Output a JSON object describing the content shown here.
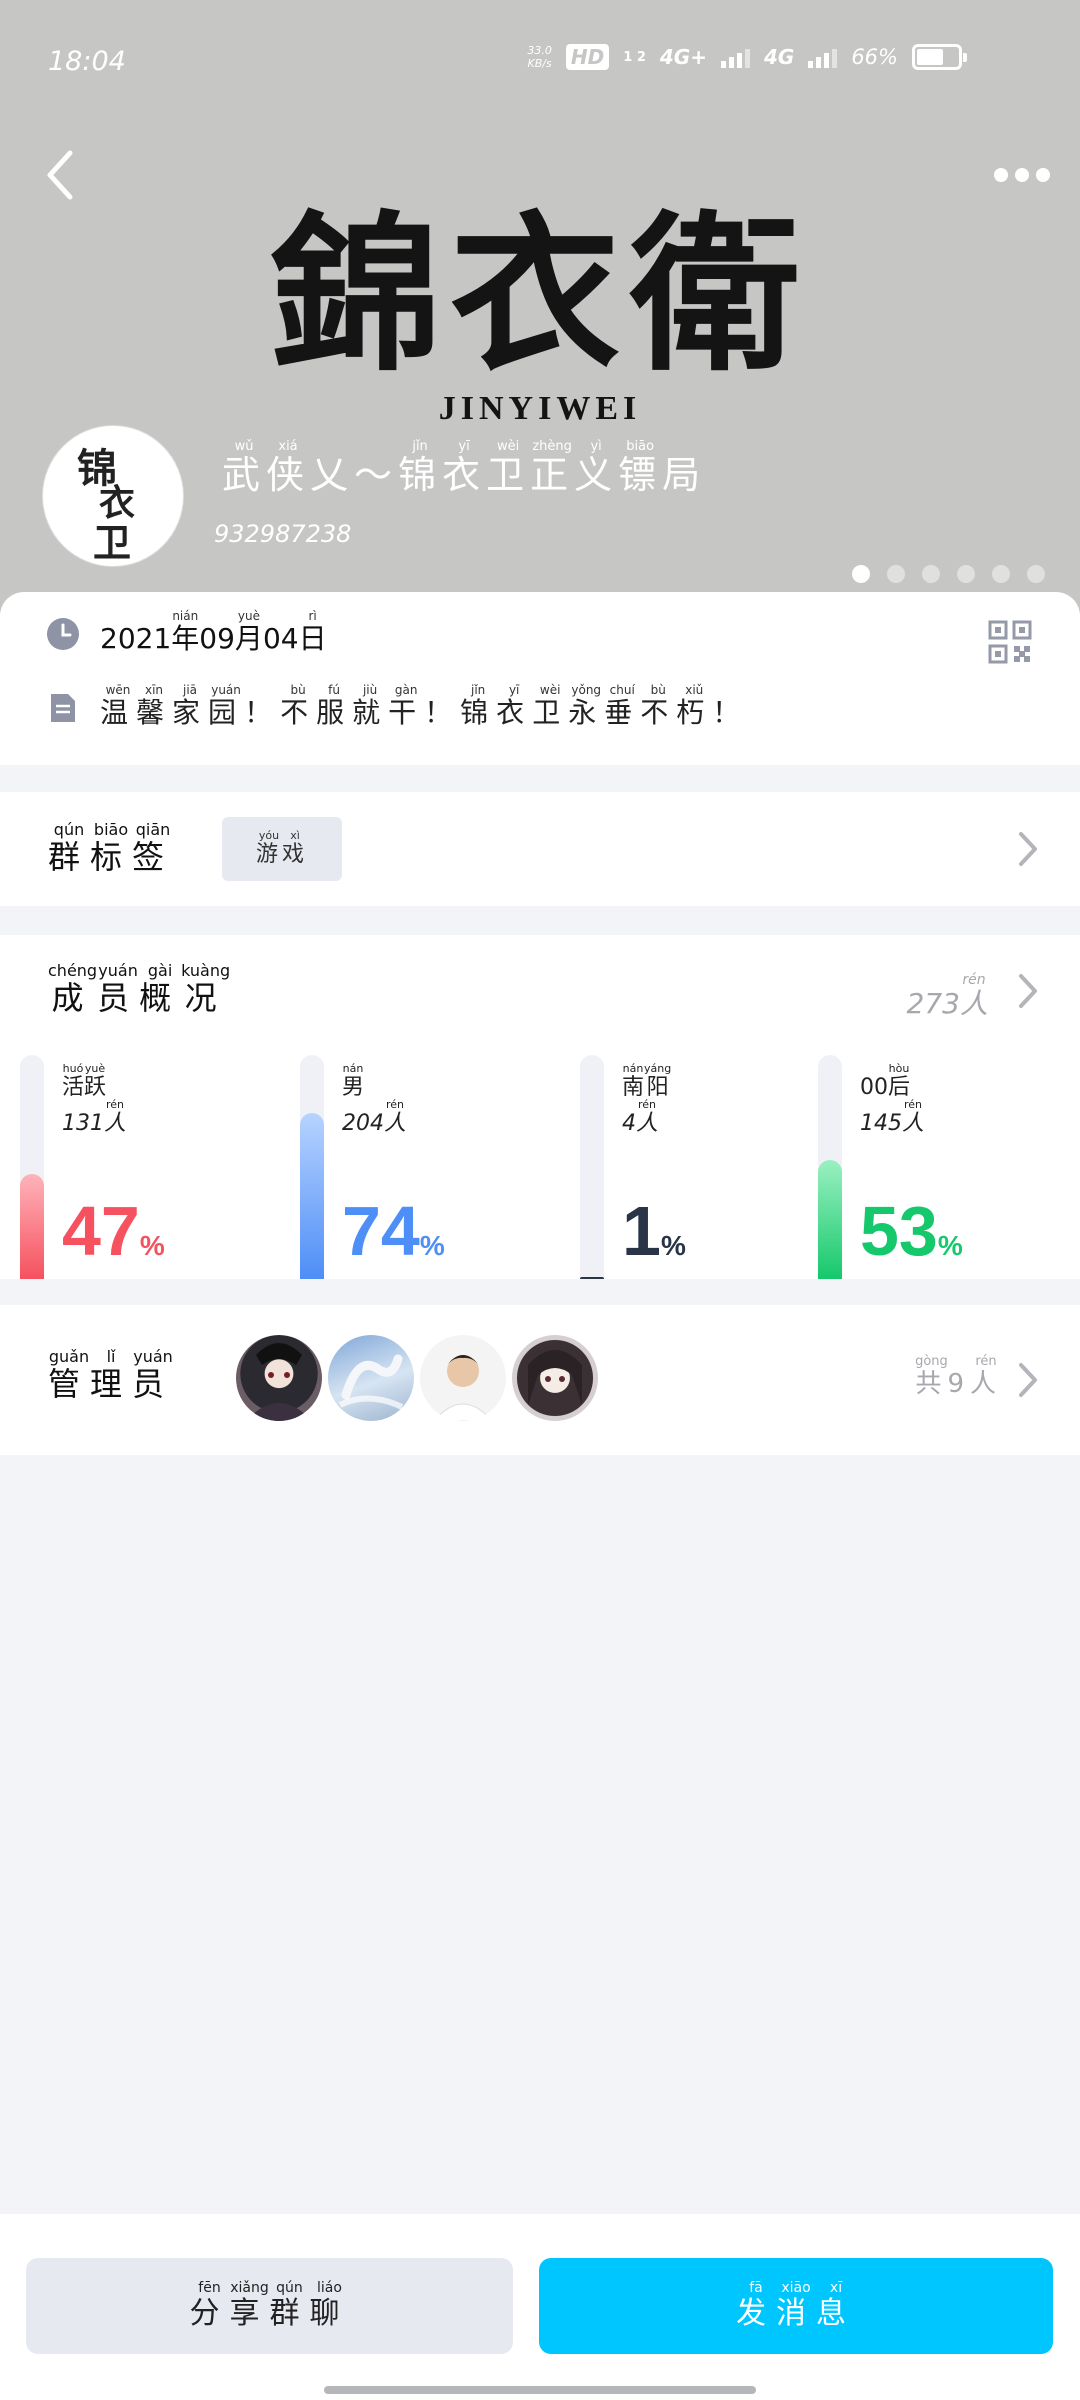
{
  "status_bar": {
    "time": "18:04",
    "speed_top": "33.0",
    "speed_bottom": "KB/s",
    "hd": "HD",
    "sim": "1 2",
    "net1": "4G+",
    "net2": "4G",
    "battery": "66%"
  },
  "header": {
    "banner_cjk": "錦衣衛",
    "banner_latin": "JINYIWEI",
    "avatar_chars": [
      "锦",
      "衣",
      "卫"
    ],
    "group_name": [
      {
        "c": "武",
        "p": "wǔ"
      },
      {
        "c": "侠",
        "p": "xiá"
      },
      {
        "c": "乂",
        "p": ""
      },
      {
        "c": "～",
        "p": ""
      },
      {
        "c": "锦",
        "p": "jǐn"
      },
      {
        "c": "衣",
        "p": "yī"
      },
      {
        "c": "卫",
        "p": "wèi"
      },
      {
        "c": "正",
        "p": "zhèng"
      },
      {
        "c": "义",
        "p": "yì"
      },
      {
        "c": "镖",
        "p": "biāo"
      },
      {
        "c": "局",
        "p": ""
      }
    ],
    "group_id": "932987238",
    "carousel_count": 6,
    "carousel_active": 0
  },
  "info": {
    "date": [
      {
        "c": "2021",
        "p": ""
      },
      {
        "c": "年",
        "p": "nián"
      },
      {
        "c": "09",
        "p": ""
      },
      {
        "c": "月",
        "p": "yuè"
      },
      {
        "c": "04",
        "p": ""
      },
      {
        "c": "日",
        "p": "rì"
      }
    ],
    "description": [
      {
        "c": "温",
        "p": "wēn"
      },
      {
        "c": "馨",
        "p": "xīn"
      },
      {
        "c": "家",
        "p": "jiā"
      },
      {
        "c": "园",
        "p": "yuán"
      },
      {
        "c": "！",
        "p": ""
      },
      {
        "c": "不",
        "p": "bù"
      },
      {
        "c": "服",
        "p": "fú"
      },
      {
        "c": "就",
        "p": "jiù"
      },
      {
        "c": "干",
        "p": "gàn"
      },
      {
        "c": "！",
        "p": ""
      },
      {
        "c": "锦",
        "p": "jǐn"
      },
      {
        "c": "衣",
        "p": "yī"
      },
      {
        "c": "卫",
        "p": "wèi"
      },
      {
        "c": "永",
        "p": "yǒng"
      },
      {
        "c": "垂",
        "p": "chuí"
      },
      {
        "c": "不",
        "p": "bù"
      },
      {
        "c": "朽",
        "p": "xiǔ"
      },
      {
        "c": "！",
        "p": ""
      }
    ]
  },
  "tags": {
    "title": [
      {
        "c": "群",
        "p": "qún"
      },
      {
        "c": "标",
        "p": "biāo"
      },
      {
        "c": "签",
        "p": "qiān"
      }
    ],
    "items": [
      [
        {
          "c": "游",
          "p": "yóu"
        },
        {
          "c": "戏",
          "p": "xì"
        }
      ]
    ]
  },
  "members": {
    "title": [
      {
        "c": "成",
        "p": "chéng"
      },
      {
        "c": "员",
        "p": "yuán"
      },
      {
        "c": "概",
        "p": "gài"
      },
      {
        "c": "况",
        "p": "kuàng"
      }
    ],
    "total": [
      {
        "c": "273",
        "p": ""
      },
      {
        "c": "人",
        "p": "rén"
      }
    ],
    "stats": [
      {
        "label": [
          {
            "c": "活",
            "p": "huó"
          },
          {
            "c": "跃",
            "p": "yuè"
          }
        ],
        "count": [
          {
            "c": "131",
            "p": ""
          },
          {
            "c": "人",
            "p": "rén"
          }
        ],
        "percent": 47,
        "percent_text": "47",
        "color": "#f5515f",
        "color_light": "#ffb3ba"
      },
      {
        "label": [
          {
            "c": "男",
            "p": "nán"
          }
        ],
        "count": [
          {
            "c": "204",
            "p": ""
          },
          {
            "c": "人",
            "p": "rén"
          }
        ],
        "percent": 74,
        "percent_text": "74",
        "color": "#4e8ef7",
        "color_light": "#b7d3ff"
      },
      {
        "label": [
          {
            "c": "南",
            "p": "nán"
          },
          {
            "c": "阳",
            "p": "yáng"
          }
        ],
        "count": [
          {
            "c": "4",
            "p": ""
          },
          {
            "c": "人",
            "p": "rén"
          }
        ],
        "percent": 1,
        "percent_text": "1",
        "color": "#2a3447",
        "color_light": "#2a3447"
      },
      {
        "label": [
          {
            "c": "00",
            "p": ""
          },
          {
            "c": "后",
            "p": "hòu"
          }
        ],
        "count": [
          {
            "c": "145",
            "p": ""
          },
          {
            "c": "人",
            "p": "rén"
          }
        ],
        "percent": 53,
        "percent_text": "53",
        "color": "#16c86c",
        "color_light": "#9af0c1"
      }
    ],
    "percent_sign": "%"
  },
  "admins": {
    "title": [
      {
        "c": "管",
        "p": "guǎn"
      },
      {
        "c": "理",
        "p": "lǐ"
      },
      {
        "c": "员",
        "p": "yuán"
      }
    ],
    "total": [
      {
        "c": "共",
        "p": "gòng"
      },
      {
        "c": "9",
        "p": ""
      },
      {
        "c": "人",
        "p": "rén"
      }
    ],
    "avatars": [
      "avatar-1",
      "avatar-2",
      "avatar-3",
      "avatar-4"
    ]
  },
  "actions": {
    "share": [
      {
        "c": "分",
        "p": "fēn"
      },
      {
        "c": "享",
        "p": "xiǎng"
      },
      {
        "c": "群",
        "p": "qún"
      },
      {
        "c": "聊",
        "p": "liáo"
      }
    ],
    "send": [
      {
        "c": "发",
        "p": "fā"
      },
      {
        "c": "消",
        "p": "xiāo"
      },
      {
        "c": "息",
        "p": "xī"
      }
    ]
  }
}
